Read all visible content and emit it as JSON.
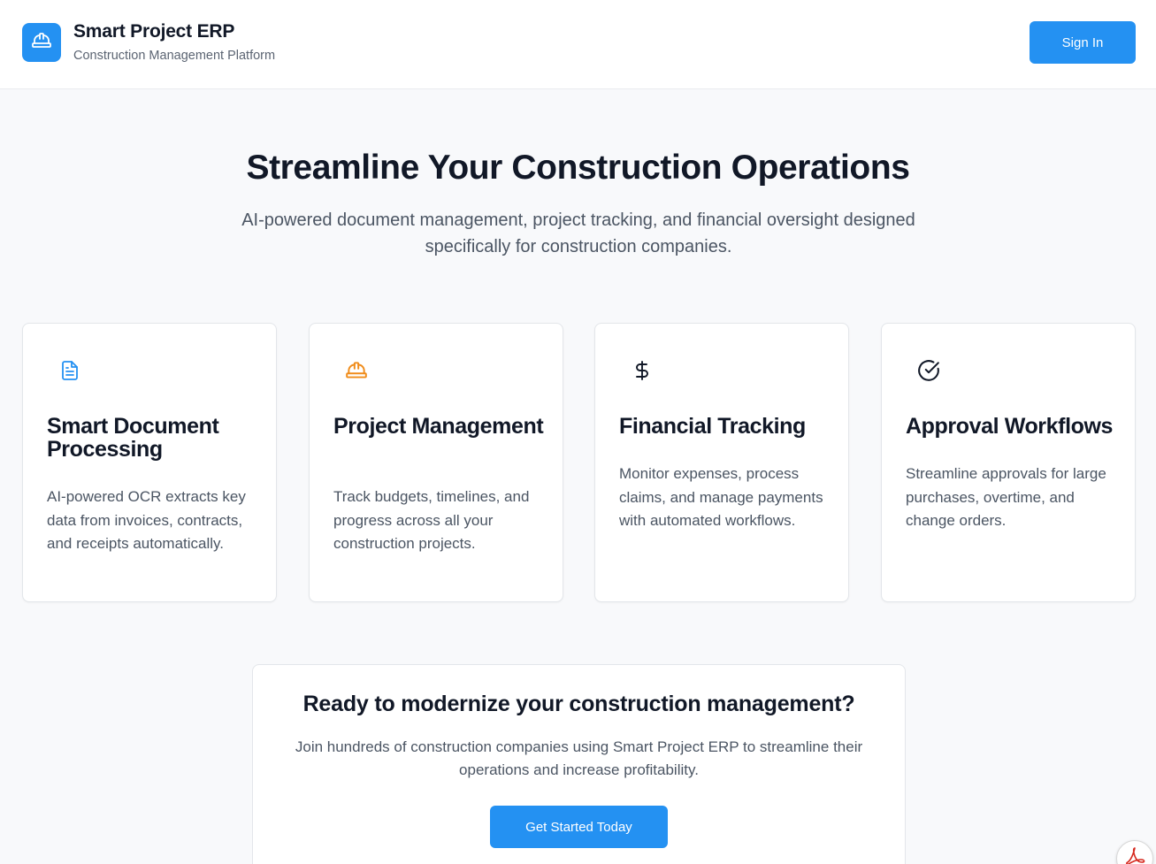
{
  "header": {
    "brand_title": "Smart Project ERP",
    "brand_subtitle": "Construction Management Platform",
    "logo_icon": "hard-hat-icon",
    "sign_in_label": "Sign In"
  },
  "hero": {
    "title": "Streamline Your Construction Operations",
    "subtitle": "AI-powered document management, project tracking, and financial oversight designed specifically for construction companies."
  },
  "features": [
    {
      "icon": "document-icon",
      "icon_color": "#2491f2",
      "title": "Smart Document Processing",
      "description": "AI-powered OCR extracts key data from invoices, contracts, and receipts automatically."
    },
    {
      "icon": "hard-hat-icon",
      "icon_color": "#f08c1a",
      "title": "Project Management",
      "description": "Track budgets, timelines, and progress across all your construction projects."
    },
    {
      "icon": "dollar-icon",
      "icon_color": "#111827",
      "title": "Financial Tracking",
      "description": "Monitor expenses, process claims, and manage payments with automated workflows."
    },
    {
      "icon": "check-circle-icon",
      "icon_color": "#111827",
      "title": "Approval Workflows",
      "description": "Streamline approvals for large purchases, overtime, and change orders."
    }
  ],
  "cta": {
    "title": "Ready to modernize your construction management?",
    "subtitle": "Join hundreds of construction companies using Smart Project ERP to streamline their operations and increase profitability.",
    "button_label": "Get Started Today"
  },
  "colors": {
    "accent": "#2491f2",
    "background": "#f8f9fb",
    "text": "#111827",
    "muted_text": "#4b5563"
  }
}
